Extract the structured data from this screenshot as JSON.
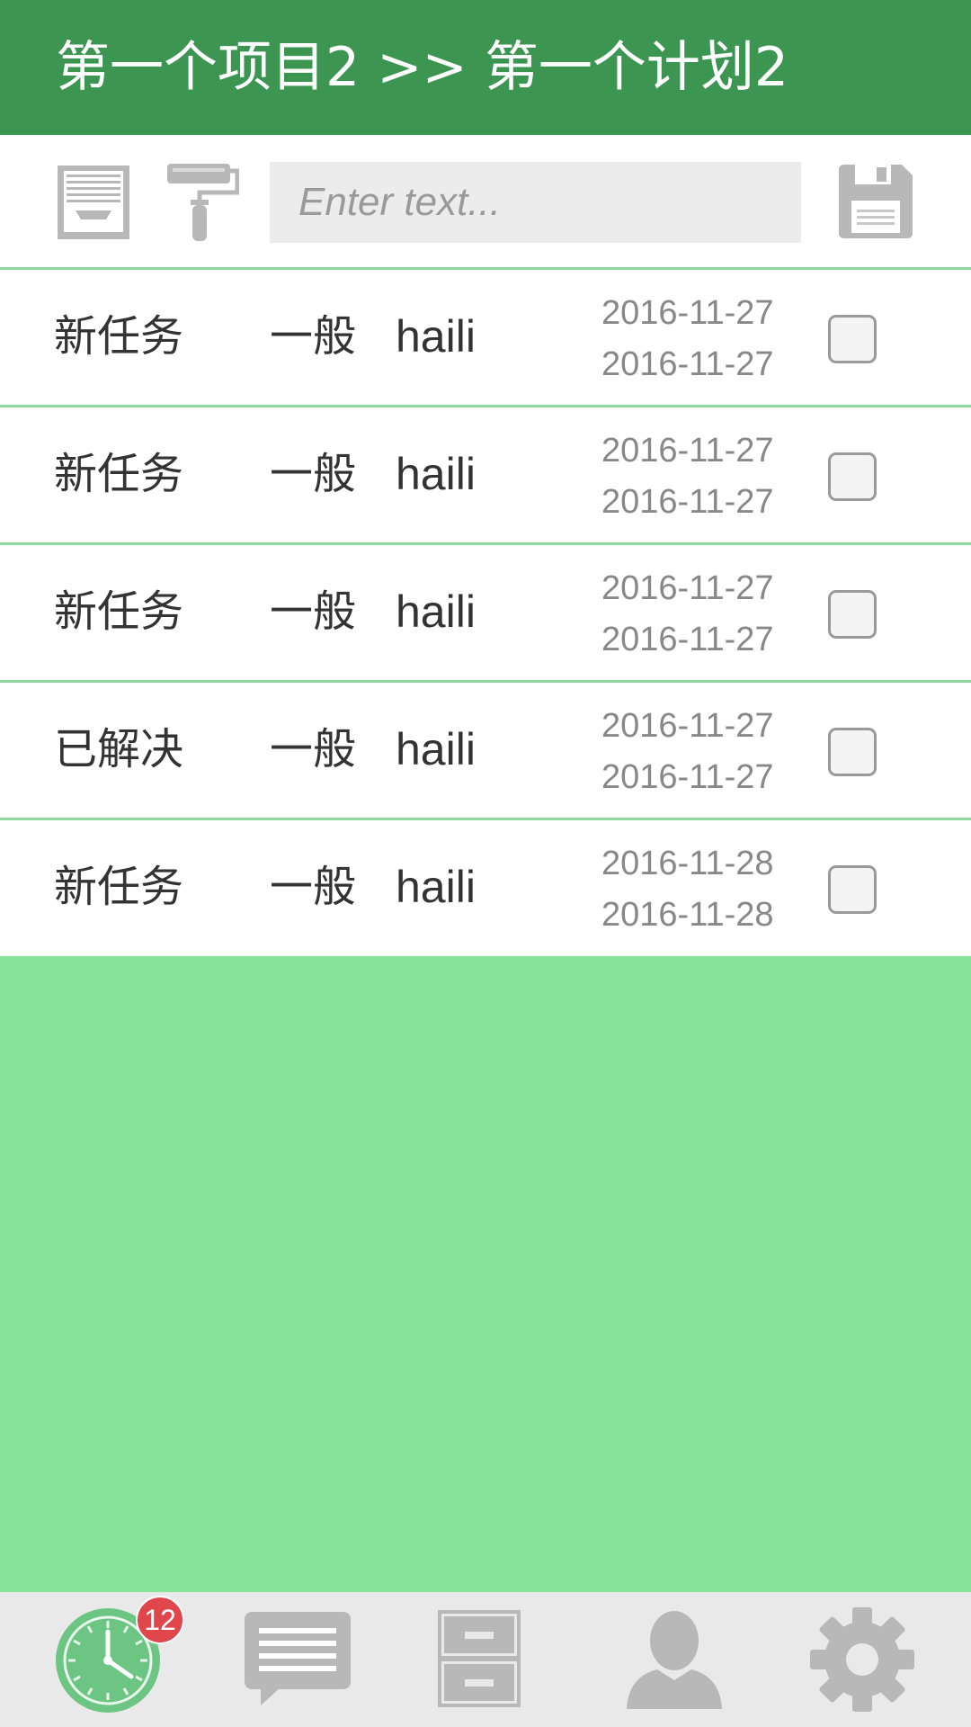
{
  "header": {
    "title": "第一个项目2 >> 第一个计划2"
  },
  "toolbar": {
    "icons": [
      "inbox-icon",
      "paint-roller-icon",
      "save-icon"
    ],
    "search_placeholder": "Enter text...",
    "search_value": ""
  },
  "tasks": [
    {
      "status": "新任务",
      "priority": "一般",
      "owner": "haili",
      "start": "2016-11-27",
      "end": "2016-11-27",
      "checked": false
    },
    {
      "status": "新任务",
      "priority": "一般",
      "owner": "haili",
      "start": "2016-11-27",
      "end": "2016-11-27",
      "checked": false
    },
    {
      "status": "新任务",
      "priority": "一般",
      "owner": "haili",
      "start": "2016-11-27",
      "end": "2016-11-27",
      "checked": false
    },
    {
      "status": "已解决",
      "priority": "一般",
      "owner": "haili",
      "start": "2016-11-27",
      "end": "2016-11-27",
      "checked": false
    },
    {
      "status": "新任务",
      "priority": "一般",
      "owner": "haili",
      "start": "2016-11-28",
      "end": "2016-11-28",
      "checked": false
    }
  ],
  "bottom_nav": {
    "items": [
      {
        "icon": "clock-icon",
        "active": true,
        "badge": "12"
      },
      {
        "icon": "message-icon",
        "active": false
      },
      {
        "icon": "file-cabinet-icon",
        "active": false
      },
      {
        "icon": "user-icon",
        "active": false
      },
      {
        "icon": "gear-icon",
        "active": false
      }
    ]
  },
  "colors": {
    "header_bg": "#3c9652",
    "accent_green": "#86e49b",
    "divider": "#8fd8a1",
    "icon_gray": "#b8b8b8",
    "badge_red": "#e0474c",
    "nav_active": "#6cc583"
  }
}
